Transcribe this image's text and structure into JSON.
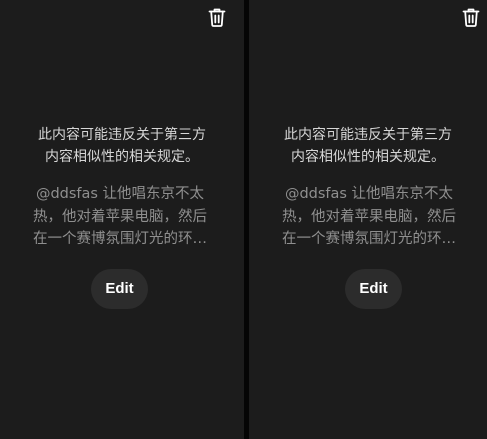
{
  "colors": {
    "panel_bg": "#1c1c1c",
    "divider": "#050505",
    "warning_text": "#d6d6d6",
    "prompt_text": "#8f8f8f",
    "button_bg": "#2c2c2c",
    "button_text": "#ffffff"
  },
  "panels": [
    {
      "delete_icon": "trash-icon",
      "warning_lines": [
        "此内容可能违反关于第三方",
        "内容相似性的相关规定。"
      ],
      "prompt_lines": [
        "@ddsfas 让他唱东京不太",
        "热，他对着苹果电脑，然后",
        "在一个赛博氛围灯光的环…"
      ],
      "edit_label": "Edit"
    },
    {
      "delete_icon": "trash-icon",
      "warning_lines": [
        "此内容可能违反关于第三方",
        "内容相似性的相关规定。"
      ],
      "prompt_lines": [
        "@ddsfas 让他唱东京不太",
        "热，他对着苹果电脑，然后",
        "在一个赛博氛围灯光的环…"
      ],
      "edit_label": "Edit"
    }
  ]
}
